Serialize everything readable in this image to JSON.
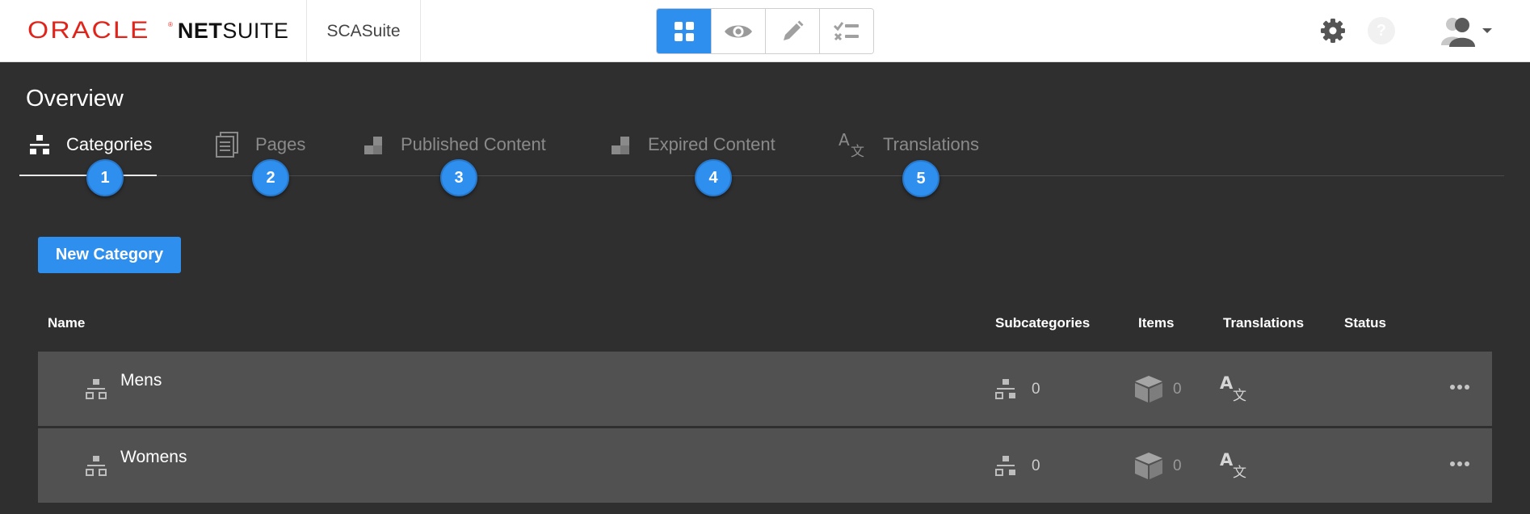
{
  "header": {
    "brand_oracle": "ORACLE",
    "brand_registered": "®",
    "brand_net": "NET",
    "brand_suite": "SUITE",
    "site_name": "SCASuite",
    "mode_buttons": [
      {
        "icon": "grid-icon",
        "active": true
      },
      {
        "icon": "eye-icon",
        "active": false
      },
      {
        "icon": "pencil-icon",
        "active": false
      },
      {
        "icon": "checklist-icon",
        "active": false
      }
    ],
    "settings_icon": "gear-icon",
    "help_label": "?",
    "user_icon": "user-avatar-icon"
  },
  "page": {
    "title": "Overview"
  },
  "tabs": [
    {
      "label": "Categories",
      "icon": "hierarchy-icon",
      "badge": "1",
      "active": true
    },
    {
      "label": "Pages",
      "icon": "pages-icon",
      "badge": "2",
      "active": false
    },
    {
      "label": "Published Content",
      "icon": "blocks-icon",
      "badge": "3",
      "active": false
    },
    {
      "label": "Expired Content",
      "icon": "blocks-icon",
      "badge": "4",
      "active": false
    },
    {
      "label": "Translations",
      "icon": "translate-icon",
      "badge": "5",
      "active": false
    }
  ],
  "actions": {
    "new_category": "New Category"
  },
  "table": {
    "columns": {
      "name": "Name",
      "subcategories": "Subcategories",
      "items": "Items",
      "translations": "Translations",
      "status": "Status"
    },
    "rows": [
      {
        "name": "Mens",
        "subcategories": "0",
        "items": "0"
      },
      {
        "name": "Womens",
        "subcategories": "0",
        "items": "0"
      }
    ]
  },
  "colors": {
    "accent": "#2f8fef",
    "background": "#2f2f2f",
    "row": "#515151",
    "oracle_red": "#e2231a"
  }
}
